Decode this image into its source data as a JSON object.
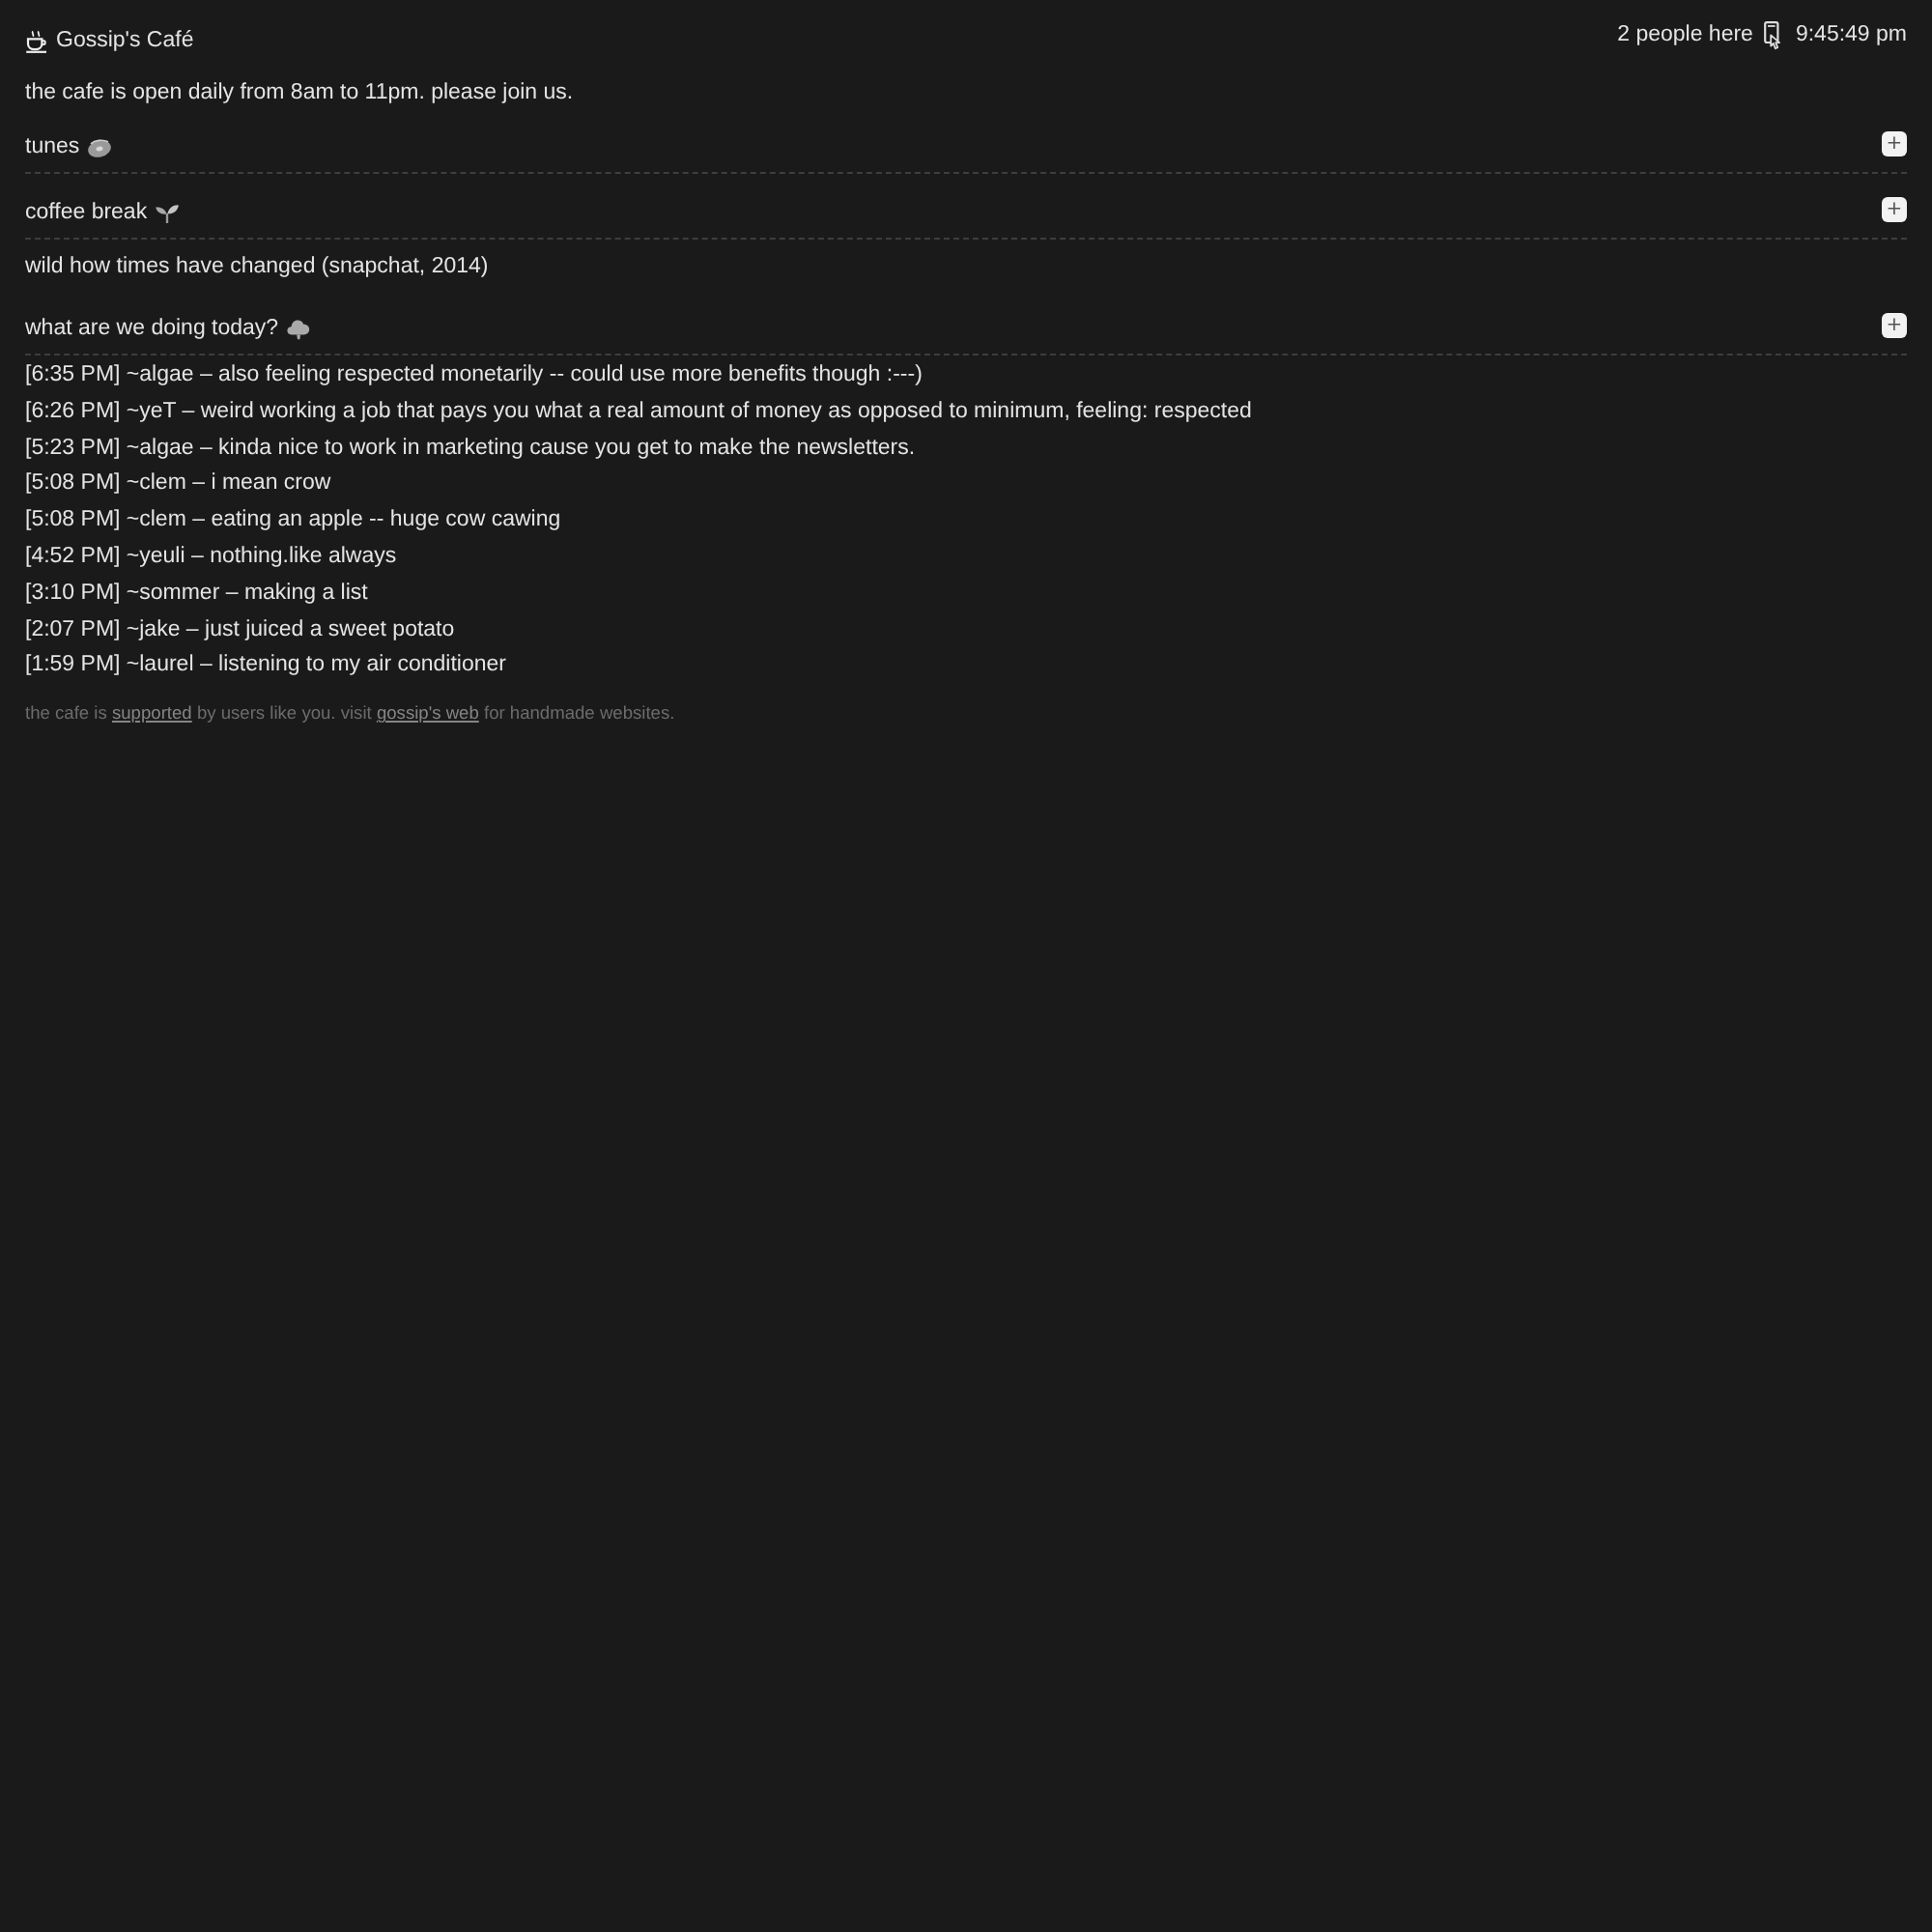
{
  "header": {
    "title": "Gossip's Café",
    "people": "2 people here",
    "time": "9:45:49 pm"
  },
  "notice": "the cafe is open daily from 8am to 11pm. please join us.",
  "sections": [
    {
      "kind": "toggle",
      "title": "tunes",
      "button": "+"
    },
    {
      "kind": "toggle",
      "title": "coffee break",
      "button": "+"
    },
    {
      "kind": "text",
      "title": "wild how times have changed (snapchat, 2014)"
    },
    {
      "kind": "toggle",
      "title": "what are we doing today?",
      "button": "+"
    }
  ],
  "messages": [
    "[6:35 PM] ~algae – also feeling respected monetarily -- could use more benefits though :---)",
    "[6:26 PM] ~yeT – weird working a job that pays you what a real amount of money as opposed to minimum, feeling: respected",
    "[5:23 PM] ~algae – kinda nice to work in marketing cause you get to make the newsletters.",
    "[5:08 PM] ~clem – i mean crow",
    "[5:08 PM] ~clem – eating an apple -- huge cow cawing",
    "[4:52 PM] ~yeuli – nothing.like always",
    "[3:10 PM] ~sommer – making a list",
    "[2:07 PM] ~jake – just juiced a sweet potato",
    "[1:59 PM] ~laurel – listening to my air conditioner"
  ],
  "footer": {
    "parts": [
      {
        "kind": "text",
        "text": "the cafe is"
      },
      {
        "kind": "link",
        "text": "supported"
      },
      {
        "kind": "text",
        "text": "by users like you. visit"
      },
      {
        "kind": "link",
        "text": "gossip's web"
      },
      {
        "kind": "text",
        "text": "for handmade websites."
      }
    ]
  }
}
